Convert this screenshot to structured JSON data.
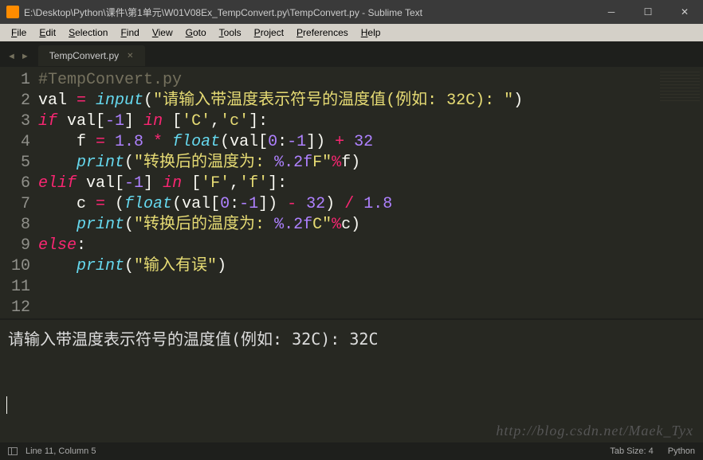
{
  "window": {
    "title": "E:\\Desktop\\Python\\课件\\第1单元\\W01V08Ex_TempConvert.py\\TempConvert.py - Sublime Text"
  },
  "menu": {
    "items": [
      "File",
      "Edit",
      "Selection",
      "Find",
      "View",
      "Goto",
      "Tools",
      "Project",
      "Preferences",
      "Help"
    ]
  },
  "tab": {
    "title": "TempConvert.py"
  },
  "editor": {
    "line_numbers": [
      "1",
      "2",
      "3",
      "4",
      "5",
      "6",
      "7",
      "8",
      "9",
      "10",
      "11",
      "12"
    ]
  },
  "code": {
    "l1_comment": "#TempConvert.py",
    "l2_val": "val ",
    "l2_eq": "=",
    "l2_input": " input",
    "l2_paren_o": "(",
    "l2_str": "\"请输入带温度表示符号的温度值(例如: 32C): \"",
    "l2_paren_c": ")",
    "l3_if": "if",
    "l3_val": " val[",
    "l3_neg1": "-1",
    "l3_brc": "] ",
    "l3_in": "in",
    "l3_sp": " [",
    "l3_C": "'C'",
    "l3_comma": ",",
    "l3_c": "'c'",
    "l3_end": "]:",
    "l4_indent": "    f ",
    "l4_eq": "=",
    "l4_18": " 1.8",
    "l4_mul": " * ",
    "l4_float": "float",
    "l4_po": "(val[",
    "l4_zero": "0",
    "l4_colon": ":",
    "l4_n1": "-1",
    "l4_pc": "]) ",
    "l4_plus": "+",
    "l4_32": " 32",
    "l5_indent": "    ",
    "l5_print": "print",
    "l5_po": "(",
    "l5_str": "\"转换后的温度为: ",
    "l5_pct": "%.2f",
    "l5_str2": "F\"",
    "l5_mod": "%",
    "l5_f": "f)",
    "l6_elif": "elif",
    "l6_val": " val[",
    "l6_neg1": "-1",
    "l6_brc": "] ",
    "l6_in": "in",
    "l6_sp": " [",
    "l6_F": "'F'",
    "l6_comma": ",",
    "l6_f": "'f'",
    "l6_end": "]:",
    "l7_indent": "    c ",
    "l7_eq": "=",
    "l7_po": " (",
    "l7_float": "float",
    "l7_po2": "(val[",
    "l7_zero": "0",
    "l7_colon": ":",
    "l7_n1": "-1",
    "l7_pc": "]) ",
    "l7_minus": "-",
    "l7_32": " 32",
    "l7_pc2": ") ",
    "l7_div": "/",
    "l7_18": " 1.8",
    "l8_indent": "    ",
    "l8_print": "print",
    "l8_po": "(",
    "l8_str": "\"转换后的温度为: ",
    "l8_pct": "%.2f",
    "l8_str2": "C\"",
    "l8_mod": "%",
    "l8_c": "c)",
    "l9_else": "else",
    "l9_colon": ":",
    "l10_indent": "    ",
    "l10_print": "print",
    "l10_po": "(",
    "l10_str": "\"输入有误\"",
    "l10_pc": ")"
  },
  "console": {
    "output": "请输入带温度表示符号的温度值(例如: 32C): 32C"
  },
  "watermark": "http://blog.csdn.net/Maek_Tyx",
  "status": {
    "cursor": "Line 11, Column 5",
    "tabsize": "Tab Size: 4",
    "syntax": "Python"
  }
}
